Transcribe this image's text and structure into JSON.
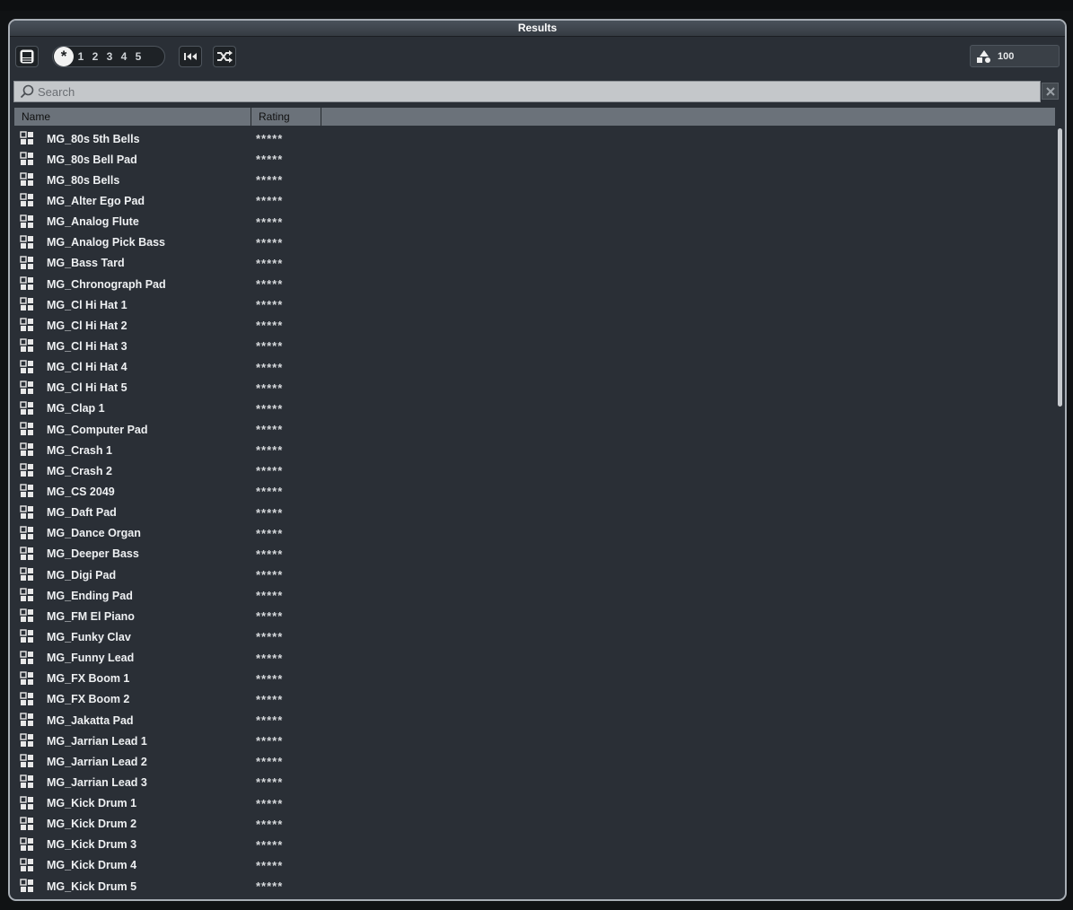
{
  "window": {
    "title": "Results"
  },
  "toolbar": {
    "rating_filter": {
      "all_symbol": "*",
      "levels": [
        "1",
        "2",
        "3",
        "4",
        "5"
      ]
    },
    "result_count": "100"
  },
  "search": {
    "placeholder": "Search",
    "value": ""
  },
  "columns": [
    "Name",
    "Rating"
  ],
  "rows": [
    {
      "name": "MG_80s 5th Bells",
      "rating": "*****"
    },
    {
      "name": "MG_80s Bell Pad",
      "rating": "*****"
    },
    {
      "name": "MG_80s Bells",
      "rating": "*****"
    },
    {
      "name": "MG_Alter Ego Pad",
      "rating": "*****"
    },
    {
      "name": "MG_Analog Flute",
      "rating": "*****"
    },
    {
      "name": "MG_Analog Pick Bass",
      "rating": "*****"
    },
    {
      "name": "MG_Bass Tard",
      "rating": "*****"
    },
    {
      "name": "MG_Chronograph Pad",
      "rating": "*****"
    },
    {
      "name": "MG_Cl Hi Hat 1",
      "rating": "*****"
    },
    {
      "name": "MG_Cl Hi Hat 2",
      "rating": "*****"
    },
    {
      "name": "MG_Cl Hi Hat 3",
      "rating": "*****"
    },
    {
      "name": "MG_Cl Hi Hat 4",
      "rating": "*****"
    },
    {
      "name": "MG_Cl Hi Hat 5",
      "rating": "*****"
    },
    {
      "name": "MG_Clap 1",
      "rating": "*****"
    },
    {
      "name": "MG_Computer Pad",
      "rating": "*****"
    },
    {
      "name": "MG_Crash 1",
      "rating": "*****"
    },
    {
      "name": "MG_Crash 2",
      "rating": "*****"
    },
    {
      "name": "MG_CS 2049",
      "rating": "*****"
    },
    {
      "name": "MG_Daft Pad",
      "rating": "*****"
    },
    {
      "name": "MG_Dance Organ",
      "rating": "*****"
    },
    {
      "name": "MG_Deeper Bass",
      "rating": "*****"
    },
    {
      "name": "MG_Digi Pad",
      "rating": "*****"
    },
    {
      "name": "MG_Ending Pad",
      "rating": "*****"
    },
    {
      "name": "MG_FM El Piano",
      "rating": "*****"
    },
    {
      "name": "MG_Funky Clav",
      "rating": "*****"
    },
    {
      "name": "MG_Funny Lead",
      "rating": "*****"
    },
    {
      "name": "MG_FX Boom 1",
      "rating": "*****"
    },
    {
      "name": "MG_FX Boom 2",
      "rating": "*****"
    },
    {
      "name": "MG_Jakatta Pad",
      "rating": "*****"
    },
    {
      "name": "MG_Jarrian Lead 1",
      "rating": "*****"
    },
    {
      "name": "MG_Jarrian Lead 2",
      "rating": "*****"
    },
    {
      "name": "MG_Jarrian Lead 3",
      "rating": "*****"
    },
    {
      "name": "MG_Kick Drum 1",
      "rating": "*****"
    },
    {
      "name": "MG_Kick Drum 2",
      "rating": "*****"
    },
    {
      "name": "MG_Kick Drum 3",
      "rating": "*****"
    },
    {
      "name": "MG_Kick Drum 4",
      "rating": "*****"
    },
    {
      "name": "MG_Kick Drum 5",
      "rating": "*****"
    }
  ],
  "icons": {
    "row": "preset-icon",
    "toolbar": [
      "browser-view-icon",
      "rewind-to-start-icon",
      "shuffle-icon",
      "instrument-filter-icon"
    ],
    "search": "search-icon",
    "clear": "close-icon"
  }
}
